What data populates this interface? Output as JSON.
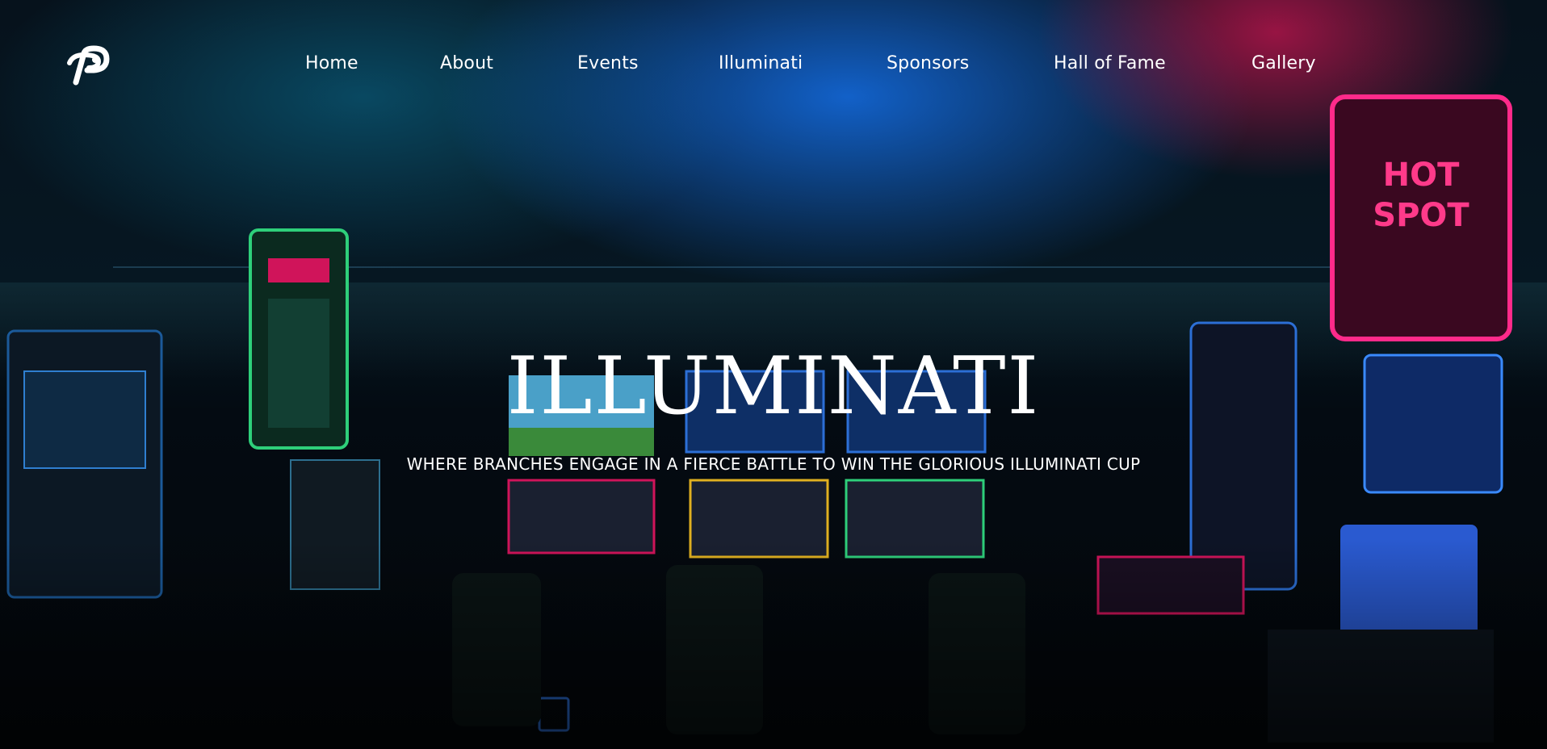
{
  "nav": {
    "logo_icon": "stylized-p-logo",
    "items": [
      {
        "label": "Home"
      },
      {
        "label": "About"
      },
      {
        "label": "Events"
      },
      {
        "label": "Illuminati"
      },
      {
        "label": "Sponsors"
      },
      {
        "label": "Hall of Fame"
      },
      {
        "label": "Gallery"
      }
    ]
  },
  "hero": {
    "title": "ILLUMINATI",
    "subtitle": "WHERE BRANCHES ENGAGE IN A FIERCE BATTLE TO WIN THE GLORIOUS ILLUMINATI CUP",
    "background": "arcade room with neon slot machines",
    "colors": {
      "text": "#ffffff",
      "glow_blue": "#1e6ee6",
      "glow_pink": "#c81450",
      "background_dark": "#05080d"
    }
  }
}
